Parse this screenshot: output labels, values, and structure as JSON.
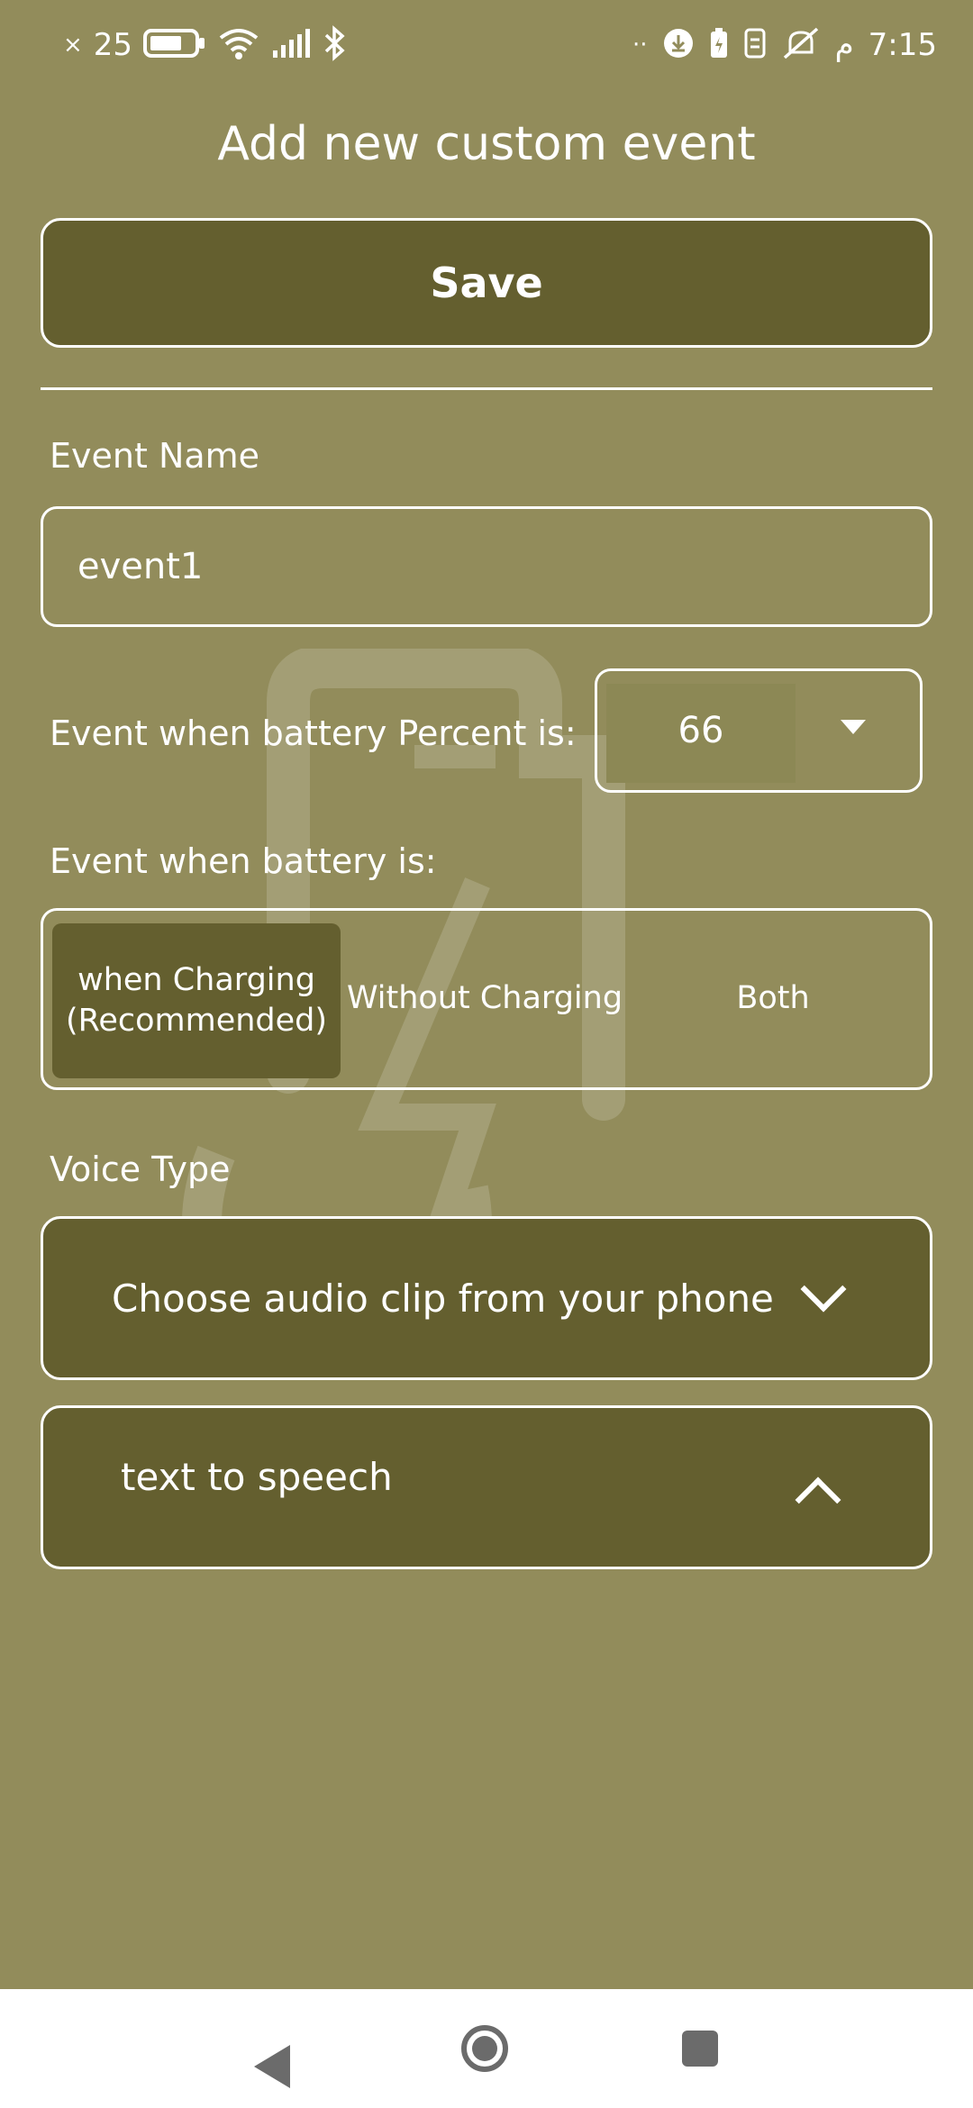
{
  "status_bar": {
    "left_text": "25",
    "right_arabic": "م",
    "time": "7:15"
  },
  "page_title": "Add new custom event",
  "save_label": "Save",
  "event_name": {
    "label": "Event Name",
    "value": "event1"
  },
  "battery_percent": {
    "label": "Event when battery Percent is:",
    "value": "66"
  },
  "battery_state": {
    "label": "Event when battery is:",
    "options": [
      "when Charging\n(Recommended)",
      "Without Charging",
      "Both"
    ],
    "selected_index": 0
  },
  "voice_type": {
    "label": "Voice Type",
    "audio_option": "Choose audio clip from your phone",
    "tts_option": "text to speech"
  },
  "colors": {
    "background": "#928c5b",
    "accent_dark": "#645f2f",
    "text": "#ffffff"
  },
  "icons": {
    "watermark": "battery-alert-icon",
    "dropdown": "caret-down-icon",
    "audio_chevron": "chevron-down-icon",
    "tts_chevron": "chevron-up-icon",
    "nav_back": "back-icon",
    "nav_home": "home-icon",
    "nav_recent": "recents-icon"
  }
}
